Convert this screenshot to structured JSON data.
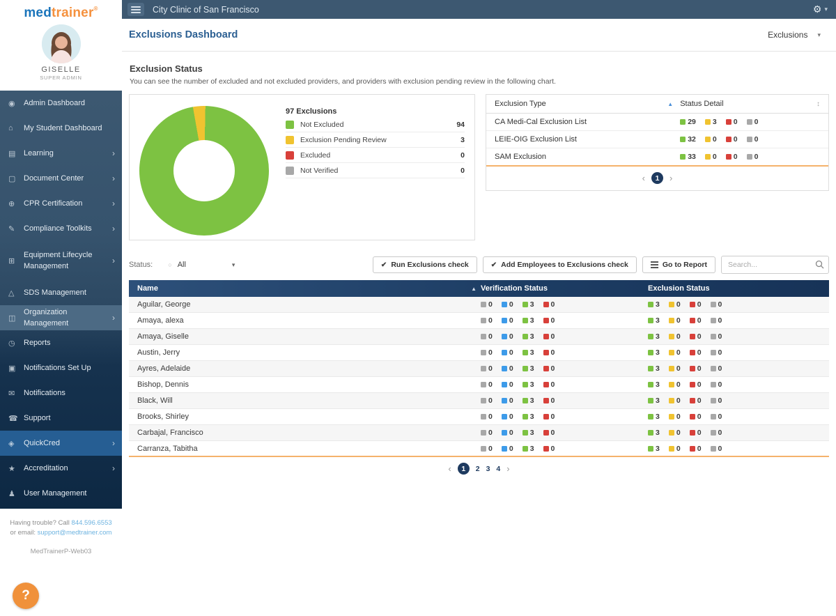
{
  "colors": {
    "green": "#7dc242",
    "yellow": "#f0c330",
    "red": "#d8403a",
    "gray": "#a8a8a8",
    "blue": "#3d9be9",
    "accent_orange": "#f0913b",
    "navy": "#1e3a5f",
    "topbar": "#3d5871",
    "title_blue": "#2b5f92"
  },
  "icons": {
    "gear": "⚙",
    "caret": "▾",
    "check": "✔",
    "sort_asc": "▲",
    "sort_both": "↕",
    "radio": "○",
    "chevron_right": "›",
    "help": "?"
  },
  "topbar": {
    "title": "City Clinic of San Francisco"
  },
  "sidebar": {
    "logo_med": "med",
    "logo_trainer": "trainer",
    "logo_reg": "®",
    "user_name": "GISELLE",
    "user_role": "SUPER ADMIN",
    "icon_glyphs": {
      "admin-dashboard": "◉",
      "student-dashboard": "⌂",
      "learning": "▤",
      "document-center": "▢",
      "cpr-certification": "⊕",
      "compliance-toolkits": "✎",
      "equipment-lifecycle": "⊞",
      "sds-management": "△",
      "organization-management": "◫",
      "reports": "◷",
      "notifications-setup": "▣",
      "notifications": "✉",
      "support": "☎",
      "quickcred": "◈",
      "accreditation": "★",
      "user-management": "♟"
    },
    "items": [
      {
        "icon": "admin-dashboard",
        "label": "Admin Dashboard"
      },
      {
        "icon": "student-dashboard",
        "label": "My Student Dashboard"
      },
      {
        "icon": "learning",
        "label": "Learning",
        "arrow": true
      },
      {
        "icon": "document-center",
        "label": "Document Center",
        "arrow": true
      },
      {
        "icon": "cpr-certification",
        "label": "CPR Certification",
        "arrow": true
      },
      {
        "icon": "compliance-toolkits",
        "label": "Compliance Toolkits",
        "arrow": true
      },
      {
        "icon": "equipment-lifecycle",
        "label": "Equipment Lifecycle Management",
        "arrow": true,
        "twoline": true
      },
      {
        "icon": "sds-management",
        "label": "SDS Management"
      },
      {
        "icon": "organization-management",
        "label": "Organization Management",
        "arrow": true,
        "active": "soft"
      },
      {
        "icon": "reports",
        "label": "Reports"
      },
      {
        "icon": "notifications-setup",
        "label": "Notifications Set Up"
      },
      {
        "icon": "notifications",
        "label": "Notifications"
      },
      {
        "icon": "support",
        "label": "Support"
      },
      {
        "icon": "quickcred",
        "label": "QuickCred",
        "arrow": true,
        "active": "bright"
      },
      {
        "icon": "accreditation",
        "label": "Accreditation",
        "arrow": true
      },
      {
        "icon": "user-management",
        "label": "User Management"
      }
    ],
    "footer": {
      "line1_prefix": "Having trouble? Call",
      "phone": "844.596.6553",
      "line1_mid": "or",
      "line2_prefix": "email:",
      "email": "support@medtrainer.com",
      "server": "MedTrainerP-Web03",
      "help": "?"
    }
  },
  "page": {
    "title": "Exclusions Dashboard",
    "view_selector": "Exclusions",
    "section_title": "Exclusion Status",
    "section_subtitle": "You can see the number of excluded and not excluded providers, and providers with exclusion pending review in the following chart."
  },
  "chart_data": {
    "type": "pie",
    "donut": true,
    "title": "97 Exclusions",
    "total": 97,
    "categories": [
      "Not Excluded",
      "Exclusion Pending Review",
      "Excluded",
      "Not Verified"
    ],
    "values": [
      94,
      3,
      0,
      0
    ],
    "colors": [
      "#7dc242",
      "#f0c330",
      "#d8403a",
      "#a8a8a8"
    ],
    "legend_position": "right"
  },
  "exclusion_type_table": {
    "col1": "Exclusion Type",
    "col2": "Status Detail",
    "rows": [
      {
        "label": "CA Medi-Cal Exclusion List",
        "badges": [
          [
            "green",
            29
          ],
          [
            "yellow",
            3
          ],
          [
            "red",
            0
          ],
          [
            "gray",
            0
          ]
        ]
      },
      {
        "label": "LEIE-OIG Exclusion List",
        "badges": [
          [
            "green",
            32
          ],
          [
            "yellow",
            0
          ],
          [
            "red",
            0
          ],
          [
            "gray",
            0
          ]
        ]
      },
      {
        "label": "SAM Exclusion",
        "badges": [
          [
            "green",
            33
          ],
          [
            "yellow",
            0
          ],
          [
            "red",
            0
          ],
          [
            "gray",
            0
          ]
        ]
      }
    ],
    "pagination": {
      "prev": "‹",
      "pages": [
        "1"
      ],
      "active": "1",
      "next": "›"
    }
  },
  "toolbar": {
    "status_label": "Status:",
    "status_value": "All",
    "run_btn": "Run Exclusions check",
    "add_btn": "Add Employees to Exclusions check",
    "report_btn": "Go to Report",
    "search_placeholder": "Search..."
  },
  "providers_table": {
    "col_name": "Name",
    "col_verification": "Verification Status",
    "col_exclusion": "Exclusion Status",
    "rows": [
      {
        "name": "Aguilar, George",
        "verification": [
          [
            "gray",
            0
          ],
          [
            "blue",
            0
          ],
          [
            "green",
            3
          ],
          [
            "red",
            0
          ]
        ],
        "exclusion": [
          [
            "green",
            3
          ],
          [
            "yellow",
            0
          ],
          [
            "red",
            0
          ],
          [
            "gray",
            0
          ]
        ]
      },
      {
        "name": "Amaya, alexa",
        "verification": [
          [
            "gray",
            0
          ],
          [
            "blue",
            0
          ],
          [
            "green",
            3
          ],
          [
            "red",
            0
          ]
        ],
        "exclusion": [
          [
            "green",
            3
          ],
          [
            "yellow",
            0
          ],
          [
            "red",
            0
          ],
          [
            "gray",
            0
          ]
        ]
      },
      {
        "name": "Amaya, Giselle",
        "verification": [
          [
            "gray",
            0
          ],
          [
            "blue",
            0
          ],
          [
            "green",
            3
          ],
          [
            "red",
            0
          ]
        ],
        "exclusion": [
          [
            "green",
            3
          ],
          [
            "yellow",
            0
          ],
          [
            "red",
            0
          ],
          [
            "gray",
            0
          ]
        ]
      },
      {
        "name": "Austin, Jerry",
        "verification": [
          [
            "gray",
            0
          ],
          [
            "blue",
            0
          ],
          [
            "green",
            3
          ],
          [
            "red",
            0
          ]
        ],
        "exclusion": [
          [
            "green",
            3
          ],
          [
            "yellow",
            0
          ],
          [
            "red",
            0
          ],
          [
            "gray",
            0
          ]
        ]
      },
      {
        "name": "Ayres, Adelaide",
        "verification": [
          [
            "gray",
            0
          ],
          [
            "blue",
            0
          ],
          [
            "green",
            3
          ],
          [
            "red",
            0
          ]
        ],
        "exclusion": [
          [
            "green",
            3
          ],
          [
            "yellow",
            0
          ],
          [
            "red",
            0
          ],
          [
            "gray",
            0
          ]
        ]
      },
      {
        "name": "Bishop, Dennis",
        "verification": [
          [
            "gray",
            0
          ],
          [
            "blue",
            0
          ],
          [
            "green",
            3
          ],
          [
            "red",
            0
          ]
        ],
        "exclusion": [
          [
            "green",
            3
          ],
          [
            "yellow",
            0
          ],
          [
            "red",
            0
          ],
          [
            "gray",
            0
          ]
        ]
      },
      {
        "name": "Black, Will",
        "verification": [
          [
            "gray",
            0
          ],
          [
            "blue",
            0
          ],
          [
            "green",
            3
          ],
          [
            "red",
            0
          ]
        ],
        "exclusion": [
          [
            "green",
            3
          ],
          [
            "yellow",
            0
          ],
          [
            "red",
            0
          ],
          [
            "gray",
            0
          ]
        ]
      },
      {
        "name": "Brooks, Shirley",
        "verification": [
          [
            "gray",
            0
          ],
          [
            "blue",
            0
          ],
          [
            "green",
            3
          ],
          [
            "red",
            0
          ]
        ],
        "exclusion": [
          [
            "green",
            3
          ],
          [
            "yellow",
            0
          ],
          [
            "red",
            0
          ],
          [
            "gray",
            0
          ]
        ]
      },
      {
        "name": "Carbajal, Francisco",
        "verification": [
          [
            "gray",
            0
          ],
          [
            "blue",
            0
          ],
          [
            "green",
            3
          ],
          [
            "red",
            0
          ]
        ],
        "exclusion": [
          [
            "green",
            3
          ],
          [
            "yellow",
            0
          ],
          [
            "red",
            0
          ],
          [
            "gray",
            0
          ]
        ]
      },
      {
        "name": "Carranza, Tabitha",
        "verification": [
          [
            "gray",
            0
          ],
          [
            "blue",
            0
          ],
          [
            "green",
            3
          ],
          [
            "red",
            0
          ]
        ],
        "exclusion": [
          [
            "green",
            3
          ],
          [
            "yellow",
            0
          ],
          [
            "red",
            0
          ],
          [
            "gray",
            0
          ]
        ]
      }
    ],
    "pagination": {
      "prev": "‹",
      "pages": [
        "1",
        "2",
        "3",
        "4"
      ],
      "active": "1",
      "next": "›"
    }
  }
}
